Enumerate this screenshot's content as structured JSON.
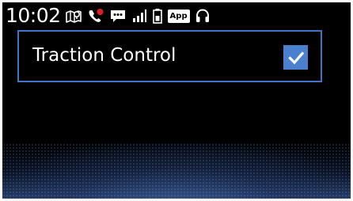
{
  "status_bar": {
    "time": "10:02",
    "icons": [
      "navigation-map-icon",
      "missed-call-icon",
      "message-icon",
      "signal-strength-icon",
      "battery-icon",
      "app-badge",
      "headset-icon"
    ],
    "app_badge_label": "App",
    "missed_call_dot_color": "#e02020"
  },
  "setting": {
    "label": "Traction Control",
    "checked": true,
    "highlight_color": "#3f76c5",
    "checkbox_color": "#4b80cf"
  }
}
